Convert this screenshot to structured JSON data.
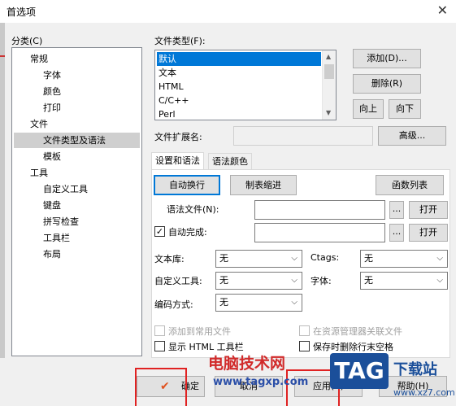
{
  "window": {
    "title": "首选项",
    "close_glyph": "✕"
  },
  "categories": {
    "label": "分类(C)",
    "items": [
      {
        "label": "常规",
        "level": 0
      },
      {
        "label": "字体",
        "level": 1
      },
      {
        "label": "颜色",
        "level": 1
      },
      {
        "label": "打印",
        "level": 1
      },
      {
        "label": "文件",
        "level": 0
      },
      {
        "label": "文件类型及语法",
        "level": 1,
        "selected": true
      },
      {
        "label": "模板",
        "level": 1
      },
      {
        "label": "工具",
        "level": 0
      },
      {
        "label": "自定义工具",
        "level": 1
      },
      {
        "label": "键盘",
        "level": 1
      },
      {
        "label": "拼写检查",
        "level": 1
      },
      {
        "label": "工具栏",
        "level": 1
      },
      {
        "label": "布局",
        "level": 1
      }
    ]
  },
  "file_types": {
    "label": "文件类型(F):",
    "items": [
      "默认",
      "文本",
      "HTML",
      "C/C++",
      "Perl"
    ],
    "selected_index": 0,
    "buttons": {
      "add": "添加(D)...",
      "delete": "删除(R)",
      "up": "向上",
      "down": "向下"
    },
    "ext_label": "文件扩展名:",
    "advanced": "高级..."
  },
  "tabs": {
    "syntax": "设置和语法",
    "colors": "语法颜色"
  },
  "panel": {
    "wrap_button": "自动换行",
    "tab_indent_button": "制表缩进",
    "func_list_button": "函数列表",
    "syntax_file_label": "语法文件(N):",
    "browse": "...",
    "open": "打开",
    "autocomplete_label": "自动完成:",
    "autocomplete_checked": true,
    "library_label": "文本库:",
    "library_value": "无",
    "ctags_label": "Ctags:",
    "ctags_value": "无",
    "custom_tool_label": "自定义工具:",
    "custom_tool_value": "无",
    "font_label": "字体:",
    "font_value": "无",
    "encoding_label": "编码方式:",
    "encoding_value": "无",
    "add_common_label": "添加到常用文件",
    "assoc_label": "在资源管理器关联文件",
    "show_html_label": "显示 HTML 工具栏",
    "trim_label": "保存时删除行末空格"
  },
  "footer": {
    "ok": "确定",
    "cancel": "取消",
    "apply": "应用(A)",
    "help": "帮助(H)",
    "ok_glyph": "✔"
  },
  "watermark": {
    "site_name": "电脑技术网",
    "site_url": "www.tagxp.com",
    "tag": "TAG",
    "tag_sub": "下载站",
    "tag_url": "www.xz7.com"
  },
  "colors": {
    "accent": "#0078d7",
    "watermark_red": "#d12a2a",
    "watermark_blue": "#1b4f9a"
  }
}
